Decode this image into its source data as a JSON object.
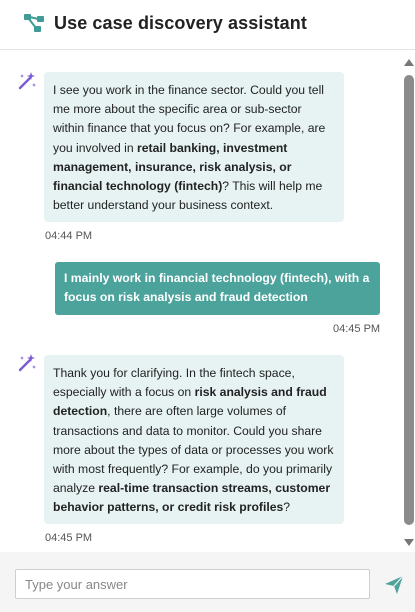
{
  "header": {
    "title": "Use case discovery assistant",
    "icon": "workflow-nodes-icon"
  },
  "colors": {
    "accent": "#4ca39c",
    "ai_bubble": "#e7f3f3",
    "sparkle": "#7b5bd6"
  },
  "messages": [
    {
      "role": "assistant",
      "parts": [
        {
          "text": "I see you work in the finance sector. Could you tell me more about the specific area or sub-sector within finance that you focus on? For example, are you involved in ",
          "bold": false
        },
        {
          "text": "retail banking, investment management, insurance, risk analysis, or financial technology (fintech)",
          "bold": true
        },
        {
          "text": "? This will help me better understand your business context.",
          "bold": false
        }
      ],
      "time": "04:44 PM"
    },
    {
      "role": "user",
      "text": "I mainly work in financial technology (fintech), with a focus on risk analysis and fraud detection",
      "time": "04:45 PM"
    },
    {
      "role": "assistant",
      "parts": [
        {
          "text": "Thank you for clarifying. In the fintech space, especially with a focus on ",
          "bold": false
        },
        {
          "text": "risk analysis and fraud detection",
          "bold": true
        },
        {
          "text": ", there are often large volumes of transactions and data to monitor. Could you share more about the types of data or processes you work with most frequently? For example, do you primarily analyze ",
          "bold": false
        },
        {
          "text": "real-time transaction streams, customer behavior patterns, or credit risk profiles",
          "bold": true
        },
        {
          "text": "?",
          "bold": false
        }
      ],
      "time": "04:45 PM"
    }
  ],
  "composer": {
    "placeholder": "Type your answer",
    "send_icon": "send-icon"
  }
}
